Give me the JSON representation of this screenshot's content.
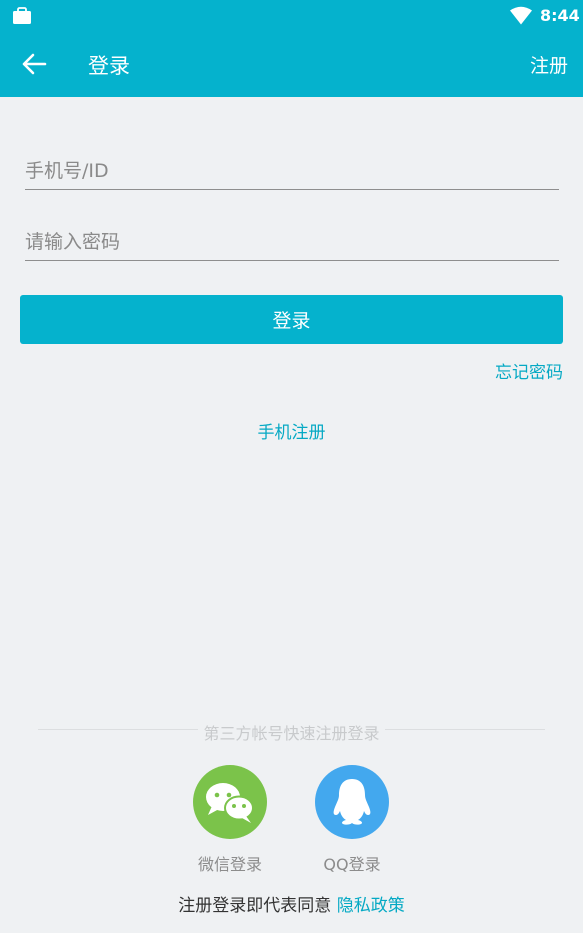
{
  "status_bar": {
    "time": "8:44",
    "icons": [
      "bag-icon",
      "wifi-icon"
    ]
  },
  "app_bar": {
    "title": "登录",
    "back_icon": "arrow-left-icon",
    "register_label": "注册"
  },
  "form": {
    "phone_placeholder": "手机号/ID",
    "phone_value": "",
    "password_placeholder": "请输入密码",
    "password_value": "",
    "login_label": "登录",
    "forgot_label": "忘记密码",
    "phone_register_label": "手机注册"
  },
  "third_party": {
    "divider_text": "第三方帐号快速注册登录",
    "wechat_label": "微信登录",
    "qq_label": "QQ登录"
  },
  "agreement": {
    "prefix": "注册登录即代表同意 ",
    "policy_label": "隐私政策"
  },
  "colors": {
    "primary": "#05b2cd",
    "link": "#05a9c4",
    "wechat": "#7bc34a",
    "qq": "#43a8ee",
    "background": "#eff1f3"
  }
}
